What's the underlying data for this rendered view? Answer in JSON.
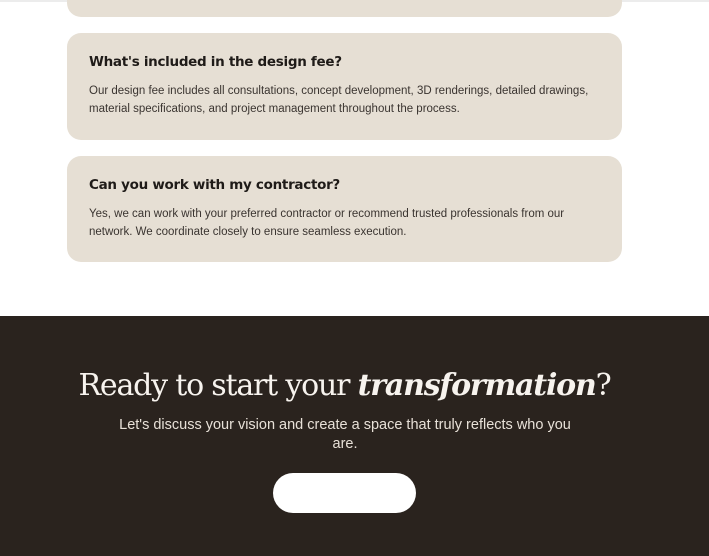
{
  "faq": {
    "items": [
      {
        "question": "What's included in the design fee?",
        "answer": "Our design fee includes all consultations, concept development, 3D renderings, detailed drawings, material specifications, and project management throughout the process."
      },
      {
        "question": "Can you work with my contractor?",
        "answer": "Yes, we can work with your preferred contractor or recommend trusted professionals from our network. We coordinate closely to ensure seamless execution."
      }
    ]
  },
  "cta": {
    "heading_prefix": "Ready to start your ",
    "heading_emphasis": "transformation",
    "heading_suffix": "?",
    "subtext": "Let's discuss your vision and create a space that truly reflects who you are.",
    "button_label": ""
  },
  "colors": {
    "card_background": "#e6dfd4",
    "cta_background": "#2a231e",
    "cta_text": "#f7f3ee",
    "button_background": "#ffffff"
  }
}
